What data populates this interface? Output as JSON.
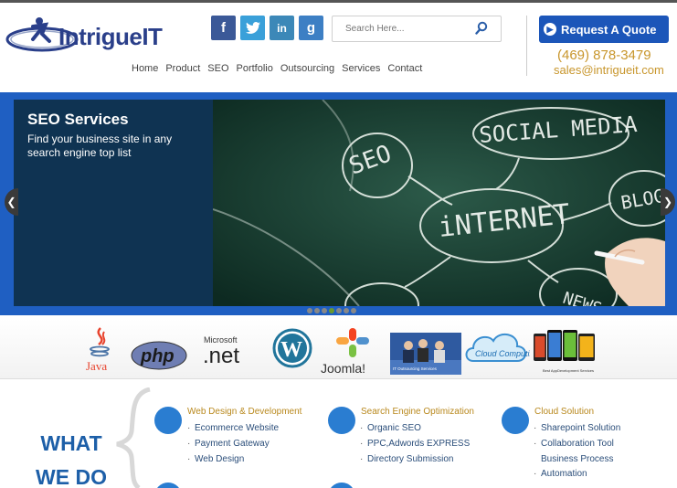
{
  "brand": {
    "logo_text": "IntrigueIT"
  },
  "social": [
    {
      "name": "facebook",
      "glyph": "f",
      "icon": "facebook-icon"
    },
    {
      "name": "twitter",
      "glyph": "t",
      "icon": "twitter-icon"
    },
    {
      "name": "linkedin",
      "glyph": "in",
      "icon": "linkedin-icon"
    },
    {
      "name": "googleplus",
      "glyph": "g",
      "icon": "google-plus-icon"
    }
  ],
  "search": {
    "placeholder": "Search Here..."
  },
  "nav": [
    "Home",
    "Product",
    "SEO",
    "Portfolio",
    "Outsourcing",
    "Services",
    "Contact"
  ],
  "quote_button": "Request A Quote",
  "contact": {
    "phone": "(469) 878-3479",
    "email": "sales@intrigueit.com"
  },
  "slider": {
    "title": "SEO Services",
    "subtitle": "Find your business site in any search engine top list",
    "board_words": [
      "SOCIAL MEDIA",
      "SEO",
      "INTERNET",
      "BLOG",
      "NEWS"
    ],
    "dot_count": 7,
    "active_dot": 4
  },
  "tech_logos": [
    {
      "label": "Java",
      "icon": "java-logo"
    },
    {
      "label": "php",
      "icon": "php-logo"
    },
    {
      "label_top": "Microsoft",
      "label": ".net",
      "icon": "dotnet-logo"
    },
    {
      "label": "W",
      "icon": "wordpress-logo"
    },
    {
      "label": "Joomla!",
      "icon": "joomla-logo"
    },
    {
      "label": "IT Outsourcing Services",
      "icon": "outsourcing-image"
    },
    {
      "label": "Cloud Computing",
      "icon": "cloud-computing-logo"
    },
    {
      "label": "Best AppDevelopment Services",
      "icon": "app-development-image"
    }
  ],
  "what_we_do": {
    "title_line1": "WHAT",
    "title_line2": "WE DO",
    "columns": [
      {
        "heading": "Web Design & Development",
        "items": [
          "Ecommerce Website",
          "Payment Gateway",
          "Web Design"
        ]
      },
      {
        "heading": "Search Engine Optimization",
        "items": [
          "Organic SEO",
          "PPC,Adwords EXPRESS",
          "Directory Submission"
        ]
      },
      {
        "heading": "Cloud Solution",
        "items": [
          "Sharepoint Solution",
          "Collaboration Tool",
          "Business Process",
          "Automation"
        ]
      }
    ]
  },
  "colors": {
    "brand_blue": "#1c56b9",
    "accent_gold": "#c8962c",
    "slider_frame": "#1f5fc2",
    "slide_panel": "#0f3352"
  }
}
